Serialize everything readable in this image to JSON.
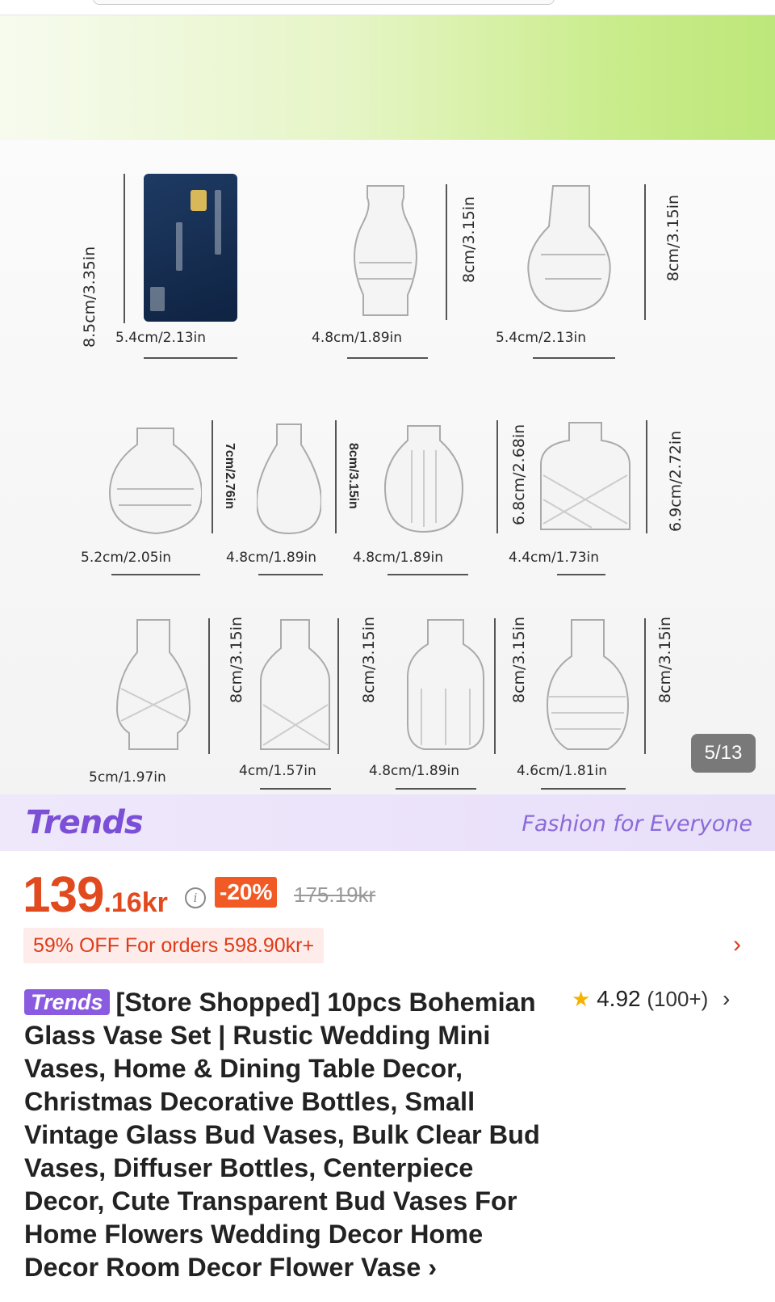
{
  "gallery": {
    "counter": "5/13",
    "dimensions": {
      "card_h": "8.5cm/3.35in",
      "card_w": "5.4cm/2.13in",
      "r1v1_w": "4.8cm/1.89in",
      "r1v1_h": "8cm/3.15in",
      "r1v2_w": "5.4cm/2.13in",
      "r1v2_h": "8cm/3.15in",
      "r2v1_w": "5.2cm/2.05in",
      "r2v2_h": "7cm/2.76in",
      "r2v2_w": "4.8cm/1.89in",
      "r2v3_h": "8cm/3.15in",
      "r2v3_w": "4.8cm/1.89in",
      "r2v4_h": "6.8cm/2.68in",
      "r2v4_w": "4.4cm/1.73in",
      "r2v4_h2": "6.9cm/2.72in",
      "r3v1_w": "5cm/1.97in",
      "r3v1_h": "8cm/3.15in",
      "r3v2_w": "4cm/1.57in",
      "r3v2_h": "8cm/3.15in",
      "r3v3_w": "4.8cm/1.89in",
      "r3v3_h": "8cm/3.15in",
      "r3v4_w": "4.6cm/1.81in",
      "r3v4_h": "8cm/3.15in"
    }
  },
  "trends_bar": {
    "logo": "Trends",
    "tagline": "Fashion for Everyone"
  },
  "pricing": {
    "price_main": "139",
    "price_cents": ".16kr",
    "info_icon": "i",
    "discount": "-20%",
    "original_price": "175.19kr",
    "promo": "59% OFF For orders 598.90kr+",
    "promo_chevron": "›"
  },
  "product": {
    "badge": "Trends",
    "title": "[Store Shopped] 10pcs Bohemian Glass Vase Set | Rustic Wedding Mini Vases, Home & Dining Table Decor, Christmas Decorative Bottles, Small Vintage Glass Bud Vases, Bulk Clear Bud Vases, Diffuser Bottles, Centerpiece Decor, Cute Transparent Bud Vases For Home Flowers Wedding Decor Home Decor Room Decor Flower Vase ›",
    "rating_star": "★",
    "rating_value": "4.92",
    "rating_count": "(100+)",
    "rating_chevron": "›"
  },
  "colors": {
    "accent": "#e04a1e",
    "trends_purple": "#7b4fd6",
    "star": "#f5b301"
  }
}
